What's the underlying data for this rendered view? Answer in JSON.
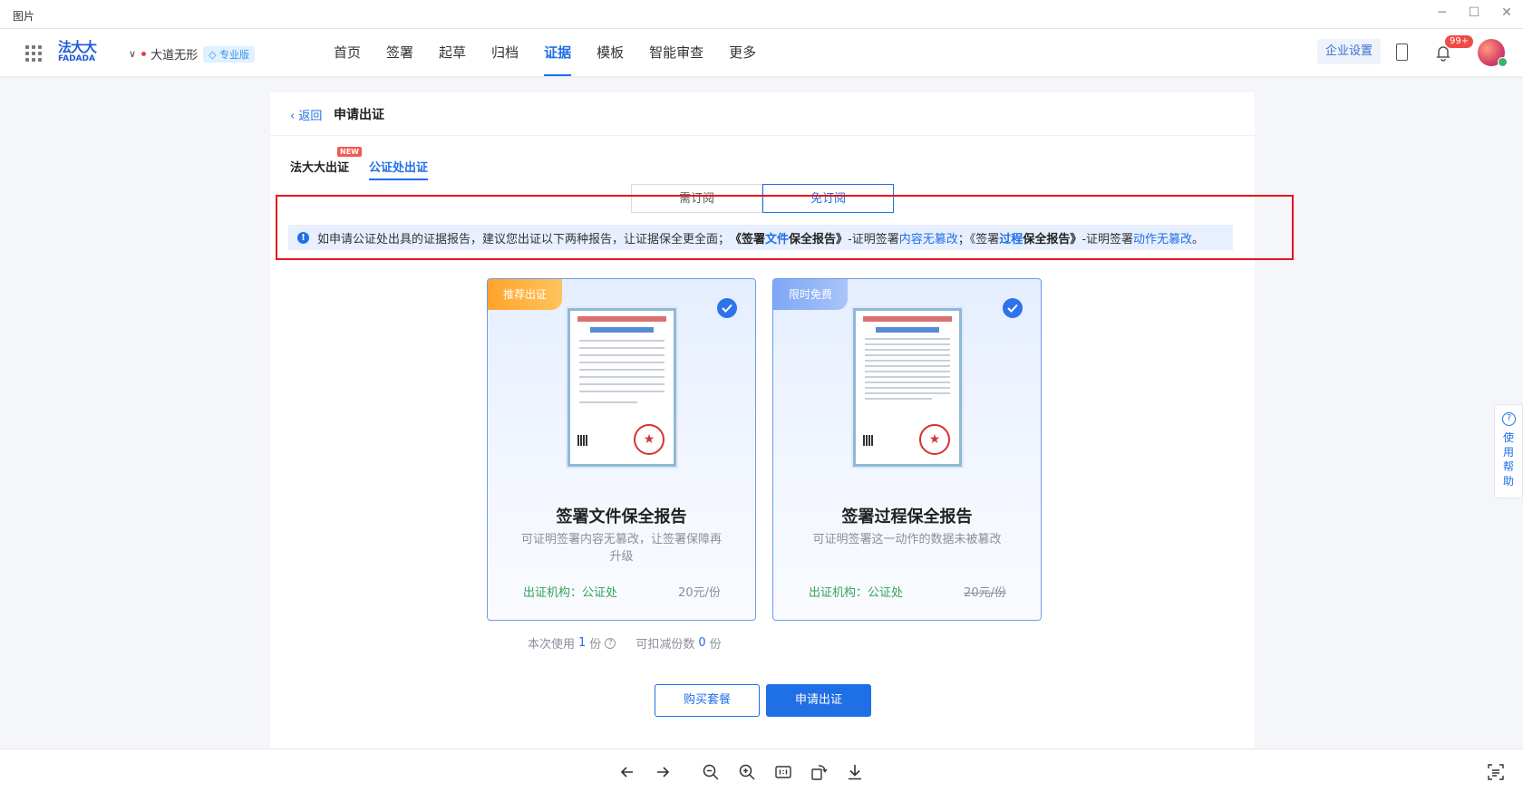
{
  "window": {
    "title": "图片"
  },
  "header": {
    "logo_top": "法大大",
    "logo_bottom": "FADADA",
    "org_name": "大道无形",
    "edition": "专业版",
    "nav": [
      "首页",
      "签署",
      "起草",
      "归档",
      "证据",
      "模板",
      "智能审查",
      "更多"
    ],
    "active_nav": "证据",
    "enterprise_settings": "企业设置",
    "notification_count": "99+"
  },
  "page": {
    "back_label": "返回",
    "title": "申请出证",
    "tabs": [
      "法大大出证",
      "公证处出证"
    ],
    "new_badge": "NEW",
    "segments": [
      "需订阅",
      "免订阅"
    ],
    "notice": {
      "t1": "如申请公证处出具的证据报告，建议您出证以下两种报告，让证据保全更全面；",
      "t2": "《签署",
      "t3": "文件",
      "t4": "保全报告》",
      "t5": "-证明签署",
      "t6": "内容无篡改",
      "t7": "；《签署",
      "t8": "过程",
      "t9": "保全报告》",
      "t10": "-证明签署",
      "t11": "动作无篡改",
      "t12": "。"
    },
    "cards": [
      {
        "ribbon": "推荐出证",
        "title": "签署文件保全报告",
        "desc": "可证明签署内容无篡改，让签署保障再升级",
        "org": "出证机构：公证处",
        "price": "20元/份"
      },
      {
        "ribbon": "限时免费",
        "title": "签署过程保全报告",
        "desc": "可证明签署这一动作的数据未被篡改",
        "org": "出证机构：公证处",
        "price": "20元/份"
      }
    ],
    "usage": {
      "label1": "本次使用",
      "count1": "1",
      "unit1": "份",
      "label2": "可扣减份数",
      "count2": "0",
      "unit2": "份"
    },
    "buy_button": "购买套餐",
    "apply_button": "申请出证",
    "help_label": "使用帮助"
  },
  "colors": {
    "primary": "#1f6fe6",
    "highlight_box": "#e8141b",
    "org_green": "#35a35b"
  }
}
